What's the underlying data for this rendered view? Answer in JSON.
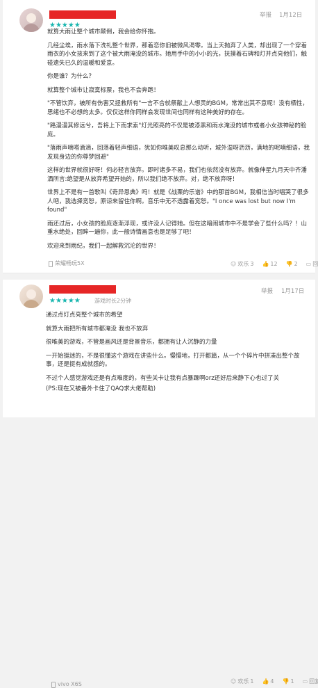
{
  "reviews": [
    {
      "avatar": "user-avatar",
      "rating_stars": "★★★★★",
      "report": "举报",
      "date": "1月12日",
      "paragraphs": [
        "就算大雨让整个城市颠倒，我会给你怀抱。",
        "几经尘埃，雨水落下洗礼整个世界，那着恋你旧被微风渴零。当上天抛弃了人类，却出现了一个穿着雨衣的小女孩来到了这个被大雨淹没的城市。她用手中的小小的光，抚摸着石碑和灯并点亮他们，触碰遗失已久的温暖和爱意。",
        "你是谁？为什么？",
        "就算整个城市让寂寞标票，我也不会奔跑！",
        "\"不管饮弃，被所有伤害又拯救所有\"一言不合就祭献上人想灵的BGM，常常出其不意呢！没有栖性，思绪也不必想的太多。仅仅这样你同样会发现世间也同样有这种美好的存在。",
        "\"路漫漫其修远兮，吾将上下而求索\"灯光照亮的不仅是被漆黑和雨水淹没的城市或者小女孩神秘的脸庞。",
        "\"落雨声嘀嗒滴滴，回荡着轻声细语，犹如你唯美叹息那么动听，城外湿呀沥沥，满地的呢喃细语，我发现身边的你尊梦回避\"",
        "这样的世界就很好呀！何必轻言放弃。即时诸多不易，我们也依然没有放弃。就像伸星九月天中齐潘洒所言:绝望是从放弃希望开始的，所以我们绝不放弃。对，绝不放弃呀！",
        "世界上不是有一首歌叫《奇异恩典》吗！就是《战栗的乐谱》中的那首BGM，我相信当时唱哭了很多人吧，我选择宽恕，原谅来留住你啊。音乐中无不透露着宽恕。\"I once was lost but now I'm found\"",
        "雨还过后，小女孩的脸庞逐渐浮现，或许没人记得她。但在这暗闹城市中不是学会了些什么吗？！山重水绝处，回眸一遍你，此一般诗情画意也是足够了吧！",
        "欢迎来到雨纪，我们一起解救沉沦的世界！"
      ],
      "device": "荣耀畅玩5X",
      "likes_label": "欢乐",
      "likes": "3",
      "comments": "12",
      "dislikes": "2",
      "replies_label": "回复"
    },
    {
      "avatar": "user-avatar",
      "rating_stars": "★★★★★",
      "playtime": "游戏时长2分钟",
      "report": "举报",
      "date": "1月17日",
      "paragraphs": [
        "通过点灯点亮整个城市的希望",
        "就算大雨把所有城市都淹没 我也不放弃",
        "很唯美的游戏，不管是画风还是背景音乐，都拥有让人沉静的力量",
        "一开始挺迷的，不是很懂这个游戏在讲些什么。慢慢地，打开都篇，从一个个碎片中拼凑出整个故事，还是挺有成就感的。",
        "不过个人感觉游戏还是有点难度的，有些关卡让我有点暴躁啊orz还好后来静下心也过了关",
        "(PS:现在又被番外卡住了QAQ求大佬帮助)"
      ],
      "device": "vivo X6S",
      "likes_label": "欢乐",
      "likes": "1",
      "comments": "4",
      "dislikes": "1",
      "replies_label": "回复"
    }
  ],
  "colors": {
    "star": "#16b5ae",
    "name_redacted": "#e62626",
    "meta": "#999999"
  }
}
